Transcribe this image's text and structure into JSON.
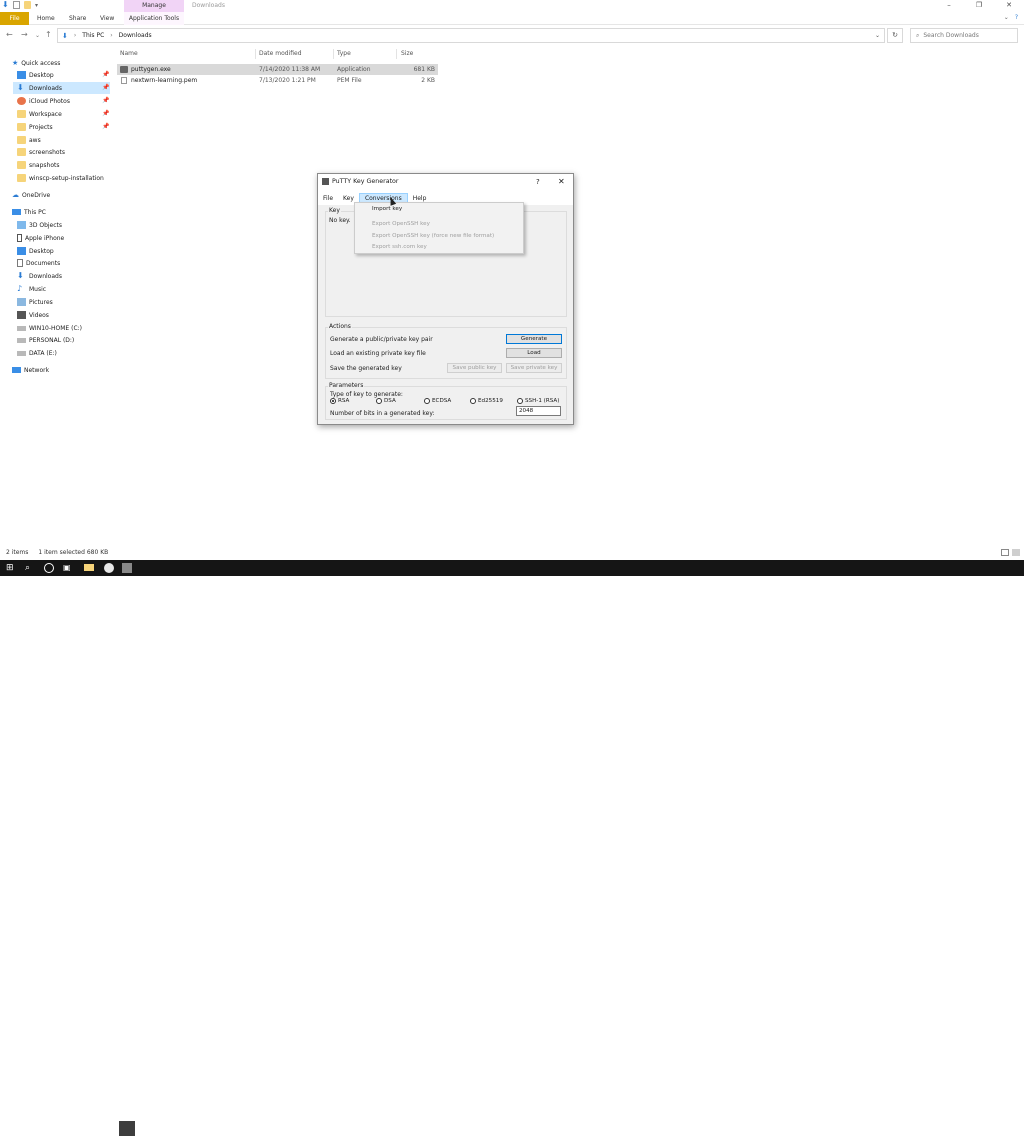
{
  "window": {
    "title": "Downloads",
    "ribbon_context": "Manage",
    "ribbon_tabs": [
      "File",
      "Home",
      "Share",
      "View",
      "Application Tools"
    ],
    "controls": [
      "–",
      "❐",
      "✕"
    ]
  },
  "address": {
    "breadcrumb": [
      "This PC",
      "Downloads"
    ],
    "search_placeholder": "Search Downloads"
  },
  "sidebar": {
    "quick_access": "Quick access",
    "pinned": [
      "Desktop",
      "Downloads",
      "iCloud Photos",
      "Workspace",
      "Projects"
    ],
    "folders": [
      "aws",
      "screenshots",
      "snapshots",
      "winscp-setup-installation"
    ],
    "onedrive": "OneDrive",
    "this_pc": "This PC",
    "pc_items": [
      "3D Objects",
      "Apple iPhone",
      "Desktop",
      "Documents",
      "Downloads",
      "Music",
      "Pictures",
      "Videos",
      "WIN10-HOME (C:)",
      "PERSONAL (D:)",
      "DATA (E:)"
    ],
    "network": "Network"
  },
  "columns": [
    "Name",
    "Date modified",
    "Type",
    "Size"
  ],
  "files": [
    {
      "name": "puttygen.exe",
      "date": "7/14/2020 11:38 AM",
      "type": "Application",
      "size": "681 KB"
    },
    {
      "name": "nextwrn-learning.pem",
      "date": "7/13/2020 1:21 PM",
      "type": "PEM File",
      "size": "2 KB"
    }
  ],
  "status": {
    "items": "2 items",
    "selected": "1 item selected  680 KB"
  },
  "putty": {
    "title": "PuTTY Key Generator",
    "help_glyph": "?",
    "close_glyph": "✕",
    "menu": [
      "File",
      "Key",
      "Conversions",
      "Help"
    ],
    "key_label": "Key",
    "no_key": "No key.",
    "actions_label": "Actions",
    "actions": [
      {
        "label": "Generate a public/private key pair",
        "button": "Generate"
      },
      {
        "label": "Load an existing private key file",
        "button": "Load"
      },
      {
        "label": "Save the generated key",
        "button1": "Save public key",
        "button2": "Save private key"
      }
    ],
    "parameters_label": "Parameters",
    "type_label": "Type of key to generate:",
    "types": [
      "RSA",
      "DSA",
      "ECDSA",
      "Ed25519",
      "SSH-1 (RSA)"
    ],
    "selected_type": "RSA",
    "bits_label": "Number of bits in a generated key:",
    "bits_value": "2048",
    "dropdown": [
      "Import key",
      "Export OpenSSH key",
      "Export OpenSSH key (force new file format)",
      "Export ssh.com key"
    ]
  },
  "colors": {
    "accent": "#0078d7",
    "file_tab": "#d9a500",
    "manage": "#f1d4f6",
    "taskbar": "#151515"
  }
}
